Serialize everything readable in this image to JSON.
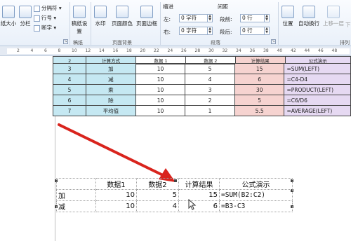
{
  "ribbon": {
    "page_setup": {
      "size_label": "纸大小",
      "columns_label": "分栏",
      "breaks_label": "分隔符",
      "line_numbers_label": "行号",
      "hyphenation_label": "断字"
    },
    "draft_group": {
      "draft_label": "稿纸设置",
      "group_label": "稿纸"
    },
    "page_background": {
      "watermark_label": "水印",
      "page_color_label": "页面颜色",
      "page_borders_label": "页面边框",
      "group_label": "页面背景"
    },
    "indent": {
      "title": "缩进",
      "left_label": "左:",
      "left_value": "0 字符",
      "right_label": "右:",
      "right_value": "0 字符"
    },
    "spacing": {
      "title": "间距",
      "before_label": "段前:",
      "before_value": "0 行",
      "after_label": "段后:",
      "after_value": "0 行"
    },
    "paragraph_group_label": "段落",
    "arrange": {
      "position_label": "位置",
      "wrap_label": "自动换行",
      "bring_forward_label": "上移一层",
      "send_backward_label": "下",
      "group_label": "排列"
    }
  },
  "ruler": {
    "ticks": [
      "2",
      "4",
      "6",
      "8",
      "10",
      "12",
      "14",
      "16",
      "18",
      "20",
      "22",
      "24",
      "26",
      "28",
      "30",
      "32",
      "34",
      "36",
      "38",
      "40",
      "42",
      "44",
      "46",
      "48"
    ]
  },
  "top_table": {
    "header": [
      "计算方式",
      "数据 1",
      "数据 2",
      "计算结果",
      "公式演示"
    ],
    "rows": [
      {
        "num": "3",
        "op": "加",
        "d1": "10",
        "d2": "5",
        "res": "15",
        "formula": "=SUM(LEFT)"
      },
      {
        "num": "4",
        "op": "减",
        "d1": "10",
        "d2": "4",
        "res": "6",
        "formula": "=C4-D4"
      },
      {
        "num": "5",
        "op": "乘",
        "d1": "10",
        "d2": "3",
        "res": "30",
        "formula": "=PRODUCT(LEFT)"
      },
      {
        "num": "6",
        "op": "除",
        "d1": "10",
        "d2": "2",
        "res": "5",
        "formula": "=C6/D6"
      },
      {
        "num": "7",
        "op": "平均值",
        "d1": "10",
        "d2": "1",
        "res": "5.5",
        "formula": "=AVERAGE(LEFT)"
      }
    ],
    "header_num": "2"
  },
  "bottom_table": {
    "header": [
      "",
      "数据1",
      "数据2",
      "计算结果",
      "公式演示"
    ],
    "rows": [
      [
        "加",
        "10",
        "5",
        "15",
        "=SUM(B2:C2)"
      ],
      [
        "减",
        "10",
        "4",
        "6",
        "=B3-C3"
      ]
    ]
  },
  "colors": {
    "arrow": "#d9241d",
    "op_col": "#c5e8f2",
    "res_col": "#f6d3d0",
    "formula_col": "#e6d9f2"
  }
}
